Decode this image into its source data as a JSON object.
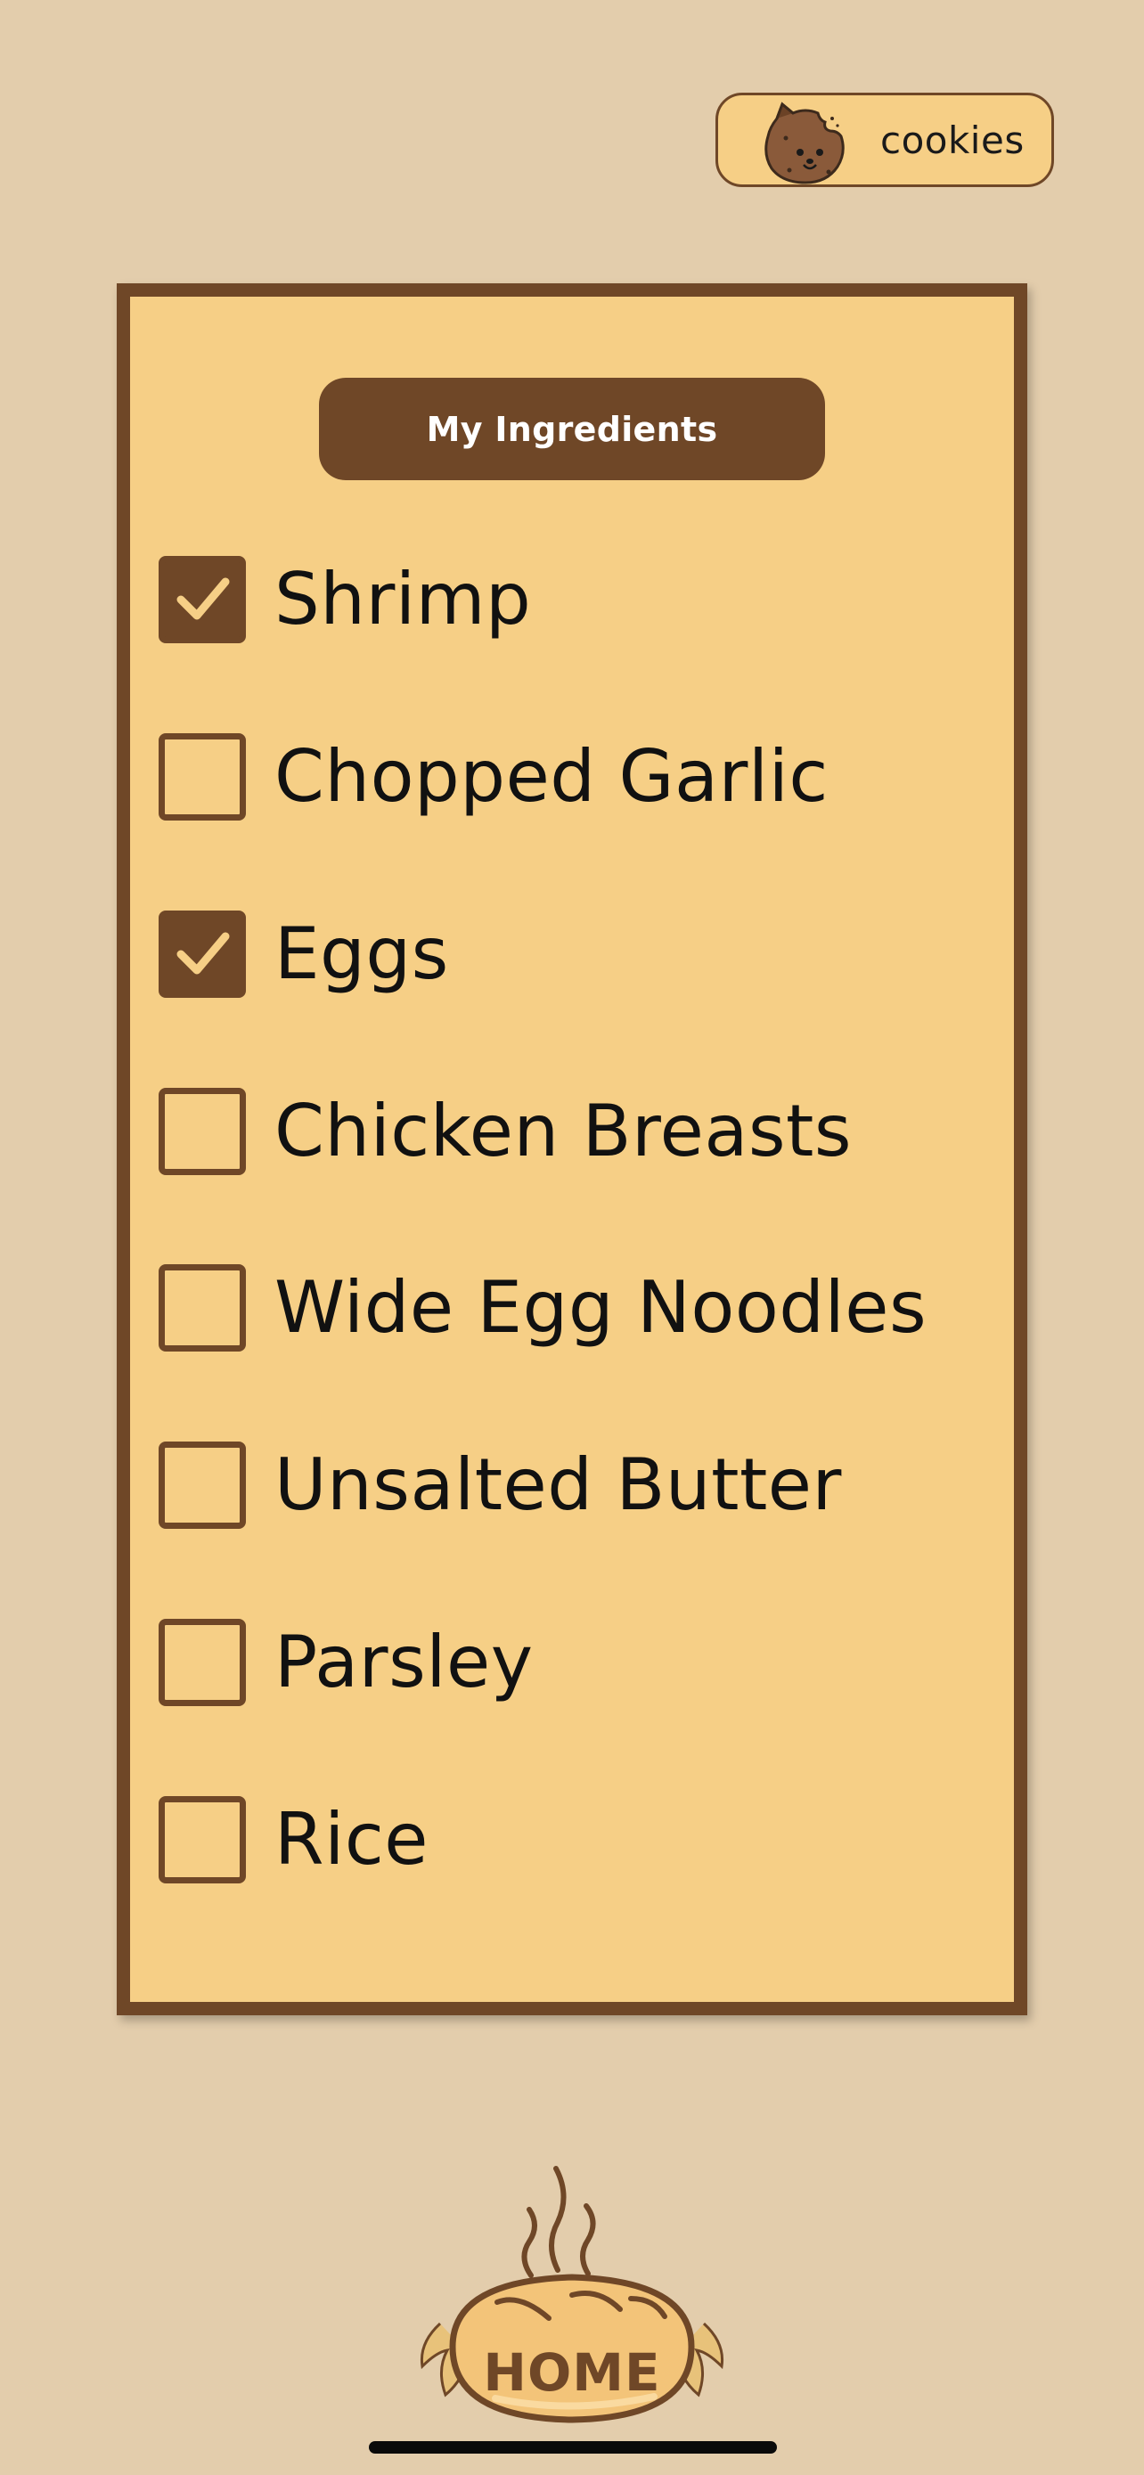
{
  "header": {
    "cookies_label": "cookies",
    "cookies_icon": "cookie-monster-icon"
  },
  "card": {
    "title": "My Ingredients",
    "ingredients": [
      {
        "label": "Shrimp",
        "checked": true
      },
      {
        "label": "Chopped Garlic",
        "checked": false
      },
      {
        "label": "Eggs",
        "checked": true
      },
      {
        "label": "Chicken Breasts",
        "checked": false
      },
      {
        "label": "Wide Egg Noodles",
        "checked": false
      },
      {
        "label": "Unsalted Butter",
        "checked": false
      },
      {
        "label": "Parsley",
        "checked": false
      },
      {
        "label": "Rice",
        "checked": false
      }
    ]
  },
  "footer": {
    "home_label": "HOME",
    "home_icon": "bread-loaf-icon"
  },
  "colors": {
    "background": "#e3cdac",
    "card": "#f6cf86",
    "accent_brown": "#6f4727"
  }
}
